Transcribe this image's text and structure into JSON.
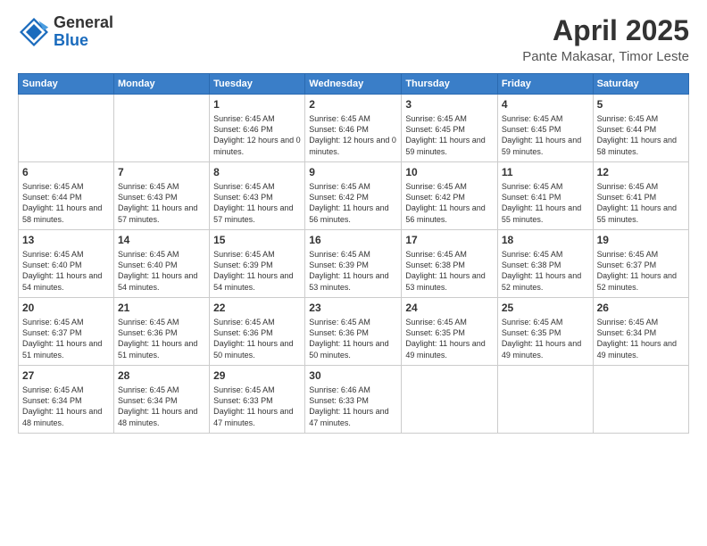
{
  "header": {
    "logo_general": "General",
    "logo_blue": "Blue",
    "month": "April 2025",
    "location": "Pante Makasar, Timor Leste"
  },
  "days_of_week": [
    "Sunday",
    "Monday",
    "Tuesday",
    "Wednesday",
    "Thursday",
    "Friday",
    "Saturday"
  ],
  "weeks": [
    [
      {
        "day": "",
        "sunrise": "",
        "sunset": "",
        "daylight": ""
      },
      {
        "day": "",
        "sunrise": "",
        "sunset": "",
        "daylight": ""
      },
      {
        "day": "1",
        "sunrise": "Sunrise: 6:45 AM",
        "sunset": "Sunset: 6:46 PM",
        "daylight": "Daylight: 12 hours and 0 minutes."
      },
      {
        "day": "2",
        "sunrise": "Sunrise: 6:45 AM",
        "sunset": "Sunset: 6:46 PM",
        "daylight": "Daylight: 12 hours and 0 minutes."
      },
      {
        "day": "3",
        "sunrise": "Sunrise: 6:45 AM",
        "sunset": "Sunset: 6:45 PM",
        "daylight": "Daylight: 11 hours and 59 minutes."
      },
      {
        "day": "4",
        "sunrise": "Sunrise: 6:45 AM",
        "sunset": "Sunset: 6:45 PM",
        "daylight": "Daylight: 11 hours and 59 minutes."
      },
      {
        "day": "5",
        "sunrise": "Sunrise: 6:45 AM",
        "sunset": "Sunset: 6:44 PM",
        "daylight": "Daylight: 11 hours and 58 minutes."
      }
    ],
    [
      {
        "day": "6",
        "sunrise": "Sunrise: 6:45 AM",
        "sunset": "Sunset: 6:44 PM",
        "daylight": "Daylight: 11 hours and 58 minutes."
      },
      {
        "day": "7",
        "sunrise": "Sunrise: 6:45 AM",
        "sunset": "Sunset: 6:43 PM",
        "daylight": "Daylight: 11 hours and 57 minutes."
      },
      {
        "day": "8",
        "sunrise": "Sunrise: 6:45 AM",
        "sunset": "Sunset: 6:43 PM",
        "daylight": "Daylight: 11 hours and 57 minutes."
      },
      {
        "day": "9",
        "sunrise": "Sunrise: 6:45 AM",
        "sunset": "Sunset: 6:42 PM",
        "daylight": "Daylight: 11 hours and 56 minutes."
      },
      {
        "day": "10",
        "sunrise": "Sunrise: 6:45 AM",
        "sunset": "Sunset: 6:42 PM",
        "daylight": "Daylight: 11 hours and 56 minutes."
      },
      {
        "day": "11",
        "sunrise": "Sunrise: 6:45 AM",
        "sunset": "Sunset: 6:41 PM",
        "daylight": "Daylight: 11 hours and 55 minutes."
      },
      {
        "day": "12",
        "sunrise": "Sunrise: 6:45 AM",
        "sunset": "Sunset: 6:41 PM",
        "daylight": "Daylight: 11 hours and 55 minutes."
      }
    ],
    [
      {
        "day": "13",
        "sunrise": "Sunrise: 6:45 AM",
        "sunset": "Sunset: 6:40 PM",
        "daylight": "Daylight: 11 hours and 54 minutes."
      },
      {
        "day": "14",
        "sunrise": "Sunrise: 6:45 AM",
        "sunset": "Sunset: 6:40 PM",
        "daylight": "Daylight: 11 hours and 54 minutes."
      },
      {
        "day": "15",
        "sunrise": "Sunrise: 6:45 AM",
        "sunset": "Sunset: 6:39 PM",
        "daylight": "Daylight: 11 hours and 54 minutes."
      },
      {
        "day": "16",
        "sunrise": "Sunrise: 6:45 AM",
        "sunset": "Sunset: 6:39 PM",
        "daylight": "Daylight: 11 hours and 53 minutes."
      },
      {
        "day": "17",
        "sunrise": "Sunrise: 6:45 AM",
        "sunset": "Sunset: 6:38 PM",
        "daylight": "Daylight: 11 hours and 53 minutes."
      },
      {
        "day": "18",
        "sunrise": "Sunrise: 6:45 AM",
        "sunset": "Sunset: 6:38 PM",
        "daylight": "Daylight: 11 hours and 52 minutes."
      },
      {
        "day": "19",
        "sunrise": "Sunrise: 6:45 AM",
        "sunset": "Sunset: 6:37 PM",
        "daylight": "Daylight: 11 hours and 52 minutes."
      }
    ],
    [
      {
        "day": "20",
        "sunrise": "Sunrise: 6:45 AM",
        "sunset": "Sunset: 6:37 PM",
        "daylight": "Daylight: 11 hours and 51 minutes."
      },
      {
        "day": "21",
        "sunrise": "Sunrise: 6:45 AM",
        "sunset": "Sunset: 6:36 PM",
        "daylight": "Daylight: 11 hours and 51 minutes."
      },
      {
        "day": "22",
        "sunrise": "Sunrise: 6:45 AM",
        "sunset": "Sunset: 6:36 PM",
        "daylight": "Daylight: 11 hours and 50 minutes."
      },
      {
        "day": "23",
        "sunrise": "Sunrise: 6:45 AM",
        "sunset": "Sunset: 6:36 PM",
        "daylight": "Daylight: 11 hours and 50 minutes."
      },
      {
        "day": "24",
        "sunrise": "Sunrise: 6:45 AM",
        "sunset": "Sunset: 6:35 PM",
        "daylight": "Daylight: 11 hours and 49 minutes."
      },
      {
        "day": "25",
        "sunrise": "Sunrise: 6:45 AM",
        "sunset": "Sunset: 6:35 PM",
        "daylight": "Daylight: 11 hours and 49 minutes."
      },
      {
        "day": "26",
        "sunrise": "Sunrise: 6:45 AM",
        "sunset": "Sunset: 6:34 PM",
        "daylight": "Daylight: 11 hours and 49 minutes."
      }
    ],
    [
      {
        "day": "27",
        "sunrise": "Sunrise: 6:45 AM",
        "sunset": "Sunset: 6:34 PM",
        "daylight": "Daylight: 11 hours and 48 minutes."
      },
      {
        "day": "28",
        "sunrise": "Sunrise: 6:45 AM",
        "sunset": "Sunset: 6:34 PM",
        "daylight": "Daylight: 11 hours and 48 minutes."
      },
      {
        "day": "29",
        "sunrise": "Sunrise: 6:45 AM",
        "sunset": "Sunset: 6:33 PM",
        "daylight": "Daylight: 11 hours and 47 minutes."
      },
      {
        "day": "30",
        "sunrise": "Sunrise: 6:46 AM",
        "sunset": "Sunset: 6:33 PM",
        "daylight": "Daylight: 11 hours and 47 minutes."
      },
      {
        "day": "",
        "sunrise": "",
        "sunset": "",
        "daylight": ""
      },
      {
        "day": "",
        "sunrise": "",
        "sunset": "",
        "daylight": ""
      },
      {
        "day": "",
        "sunrise": "",
        "sunset": "",
        "daylight": ""
      }
    ]
  ]
}
